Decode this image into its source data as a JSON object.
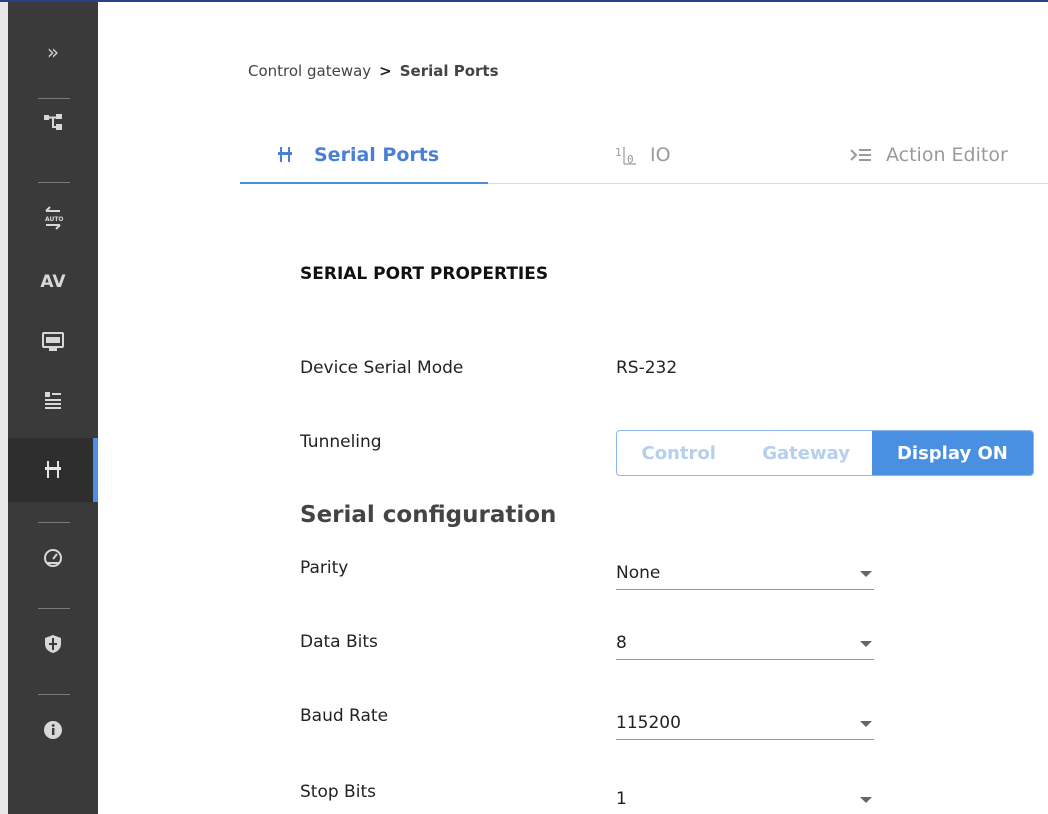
{
  "sidebar": {
    "expand_icon": "»",
    "av_label": "AV",
    "items": [
      {
        "name": "expand-icon"
      },
      {
        "name": "topology-icon"
      },
      {
        "name": "auto-switch-icon"
      },
      {
        "name": "av-item"
      },
      {
        "name": "edid-icon"
      },
      {
        "name": "settings-sliders-icon"
      },
      {
        "name": "serial-plug-icon",
        "active": true
      },
      {
        "name": "dashboard-gauge-icon"
      },
      {
        "name": "security-shield-icon"
      },
      {
        "name": "info-icon"
      }
    ],
    "colors": {
      "background": "#3a3a3a",
      "active_accent": "#4a90e2"
    }
  },
  "breadcrumb": {
    "parent": "Control gateway",
    "separator": ">",
    "current": "Serial Ports"
  },
  "tabs": [
    {
      "label": "Serial Ports",
      "icon": "serial-plug-icon",
      "active": true
    },
    {
      "label": "IO",
      "icon": "io-icon",
      "active": false
    },
    {
      "label": "Action Editor",
      "icon": "action-editor-icon",
      "active": false
    }
  ],
  "section": {
    "title": "SERIAL PORT PROPERTIES",
    "device_serial_mode": {
      "label": "Device Serial Mode",
      "value": "RS-232"
    },
    "tunneling": {
      "label": "Tunneling",
      "options": [
        "Control",
        "Gateway",
        "Display ON"
      ],
      "selected": "Display ON"
    },
    "serial_configuration": {
      "title": "Serial configuration",
      "parity": {
        "label": "Parity",
        "value": "None"
      },
      "data_bits": {
        "label": "Data Bits",
        "value": "8"
      },
      "baud_rate": {
        "label": "Baud Rate",
        "value": "115200"
      },
      "stop_bits": {
        "label": "Stop Bits",
        "value": "1"
      }
    }
  },
  "colors": {
    "accent": "#4a90e2",
    "accent_text": "#4a7fd6",
    "toggle_inactive_text": "#b6cfef"
  }
}
